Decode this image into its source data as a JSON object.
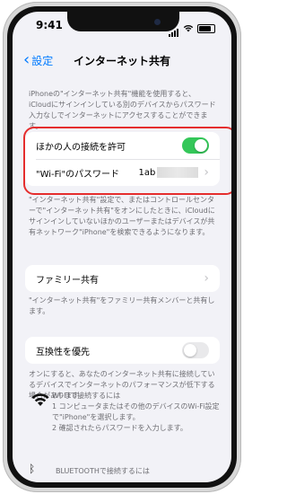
{
  "status": {
    "time": "9:41"
  },
  "nav": {
    "back_label": "設定",
    "title": "インターネット共有"
  },
  "intro_note": "iPhoneの\"インターネット共有\"機能を使用すると、iCloudにサインインしている別のデバイスからパスワード入力なしでインターネットにアクセスすることができます。",
  "allow_others": {
    "label": "ほかの人の接続を許可",
    "enabled": true
  },
  "wifi_password": {
    "label": "\"Wi-Fi\"のパスワード",
    "value": "1ab"
  },
  "hotspot_note": "\"インターネット共有\"設定で、またはコントロールセンターで\"インターネット共有\"をオンにしたときに、iCloudにサインインしていないほかのユーザーまたはデバイスが共有ネットワーク\"iPhone\"を検索できるようになります。",
  "family_sharing": {
    "label": "ファミリー共有"
  },
  "family_note": "\"インターネット共有\"をファミリー共有メンバーと共有します。",
  "compat": {
    "label": "互換性を優先",
    "enabled": false
  },
  "compat_note": "オンにすると、あなたのインターネット共有に接続しているデバイスでインターネットのパフォーマンスが低下する場合があります。",
  "wifi_connect": {
    "heading": "WI-FIで接続するには",
    "step1": "1 コンピュータまたはその他のデバイスのWi-Fi設定で\"iPhone\"を選択します。",
    "step2": "2 確認されたらパスワードを入力します。"
  },
  "bluetooth_connect": {
    "heading": "BLUETOOTHで接続するには"
  },
  "colors": {
    "accent": "#007aff",
    "toggle_on": "#34c759",
    "highlight": "#e52e2e"
  }
}
